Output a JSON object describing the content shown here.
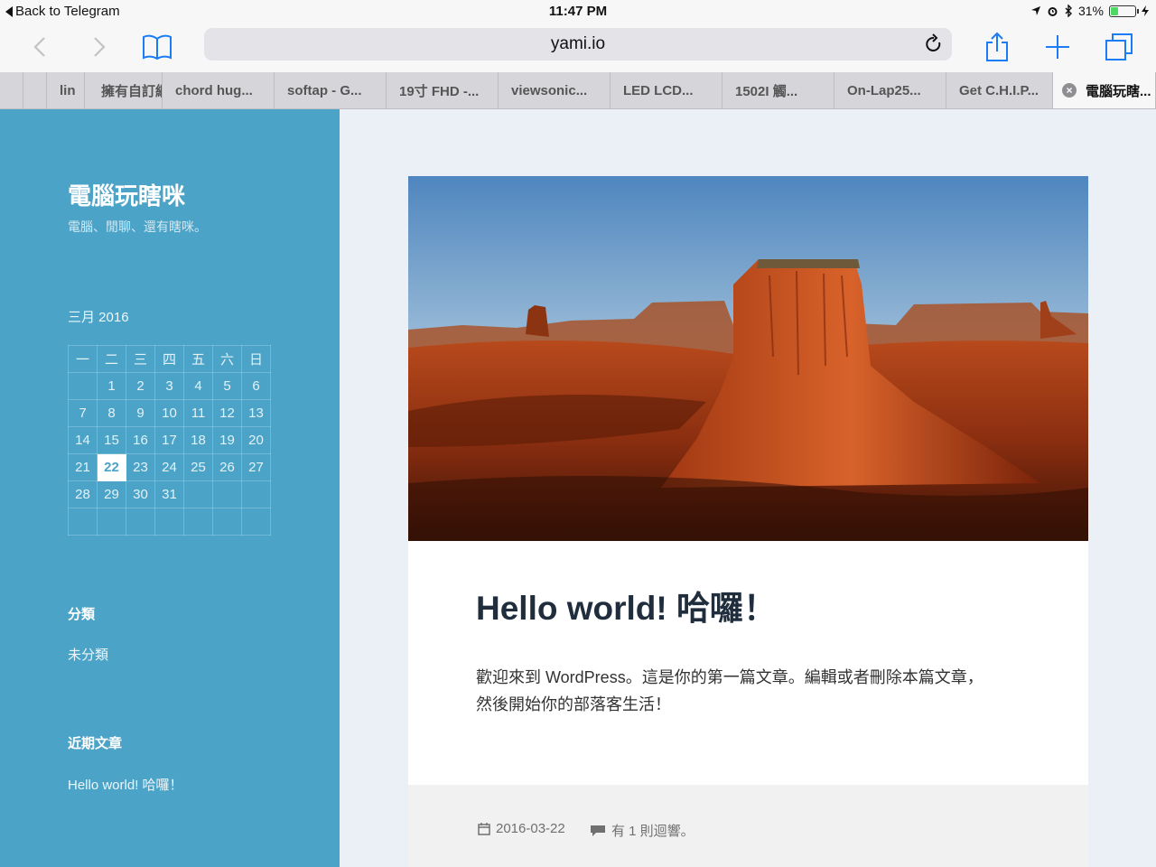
{
  "status_bar": {
    "back_label": "Back to Telegram",
    "time": "11:47 PM",
    "battery": "31%",
    "battery_level": 0.31
  },
  "toolbar": {
    "url": "yami.io",
    "icons": [
      "back-icon",
      "forward-icon",
      "bookmarks-icon",
      "reload-icon",
      "share-icon",
      "new-tab-icon",
      "tabs-icon"
    ]
  },
  "tabs": [
    {
      "label": "lin"
    },
    {
      "label": "擁有自訂網"
    },
    {
      "label": "chord hug..."
    },
    {
      "label": "softap - G..."
    },
    {
      "label": "19寸 FHD -..."
    },
    {
      "label": "viewsonic..."
    },
    {
      "label": "LED LCD..."
    },
    {
      "label": "1502I 觸..."
    },
    {
      "label": "On-Lap25..."
    },
    {
      "label": "Get C.H.I.P..."
    },
    {
      "label": "電腦玩瞎...",
      "active": true
    }
  ],
  "sidebar": {
    "site_title": "電腦玩瞎咪",
    "site_description": "電腦、閒聊、還有瞎咪。",
    "calendar": {
      "caption": "三月 2016",
      "weekdays": [
        "一",
        "二",
        "三",
        "四",
        "五",
        "六",
        "日"
      ],
      "rows": [
        [
          "",
          "1",
          "2",
          "3",
          "4",
          "5",
          "6"
        ],
        [
          "7",
          "8",
          "9",
          "10",
          "11",
          "12",
          "13"
        ],
        [
          "14",
          "15",
          "16",
          "17",
          "18",
          "19",
          "20"
        ],
        [
          "21",
          "22",
          "23",
          "24",
          "25",
          "26",
          "27"
        ],
        [
          "28",
          "29",
          "30",
          "31",
          "",
          "",
          ""
        ],
        [
          "",
          "",
          "",
          "",
          "",
          "",
          ""
        ]
      ],
      "today": "22"
    },
    "categories_title": "分類",
    "categories": [
      "未分類"
    ],
    "recent_title": "近期文章",
    "recent_posts": [
      "Hello world! 哈囉！"
    ]
  },
  "post": {
    "title": "Hello world! 哈囉！",
    "body_line1": "歡迎來到 WordPress。這是你的第一篇文章。編輯或者刪除本篇文章，",
    "body_line2": "然後開始你的部落客生活！",
    "date": "2016-03-22",
    "comments": "有 1 則迴響。"
  },
  "colors": {
    "sidebar": "#4ba3c7",
    "page_bg": "#eaf0f6",
    "accent": "#1b7cf6"
  }
}
